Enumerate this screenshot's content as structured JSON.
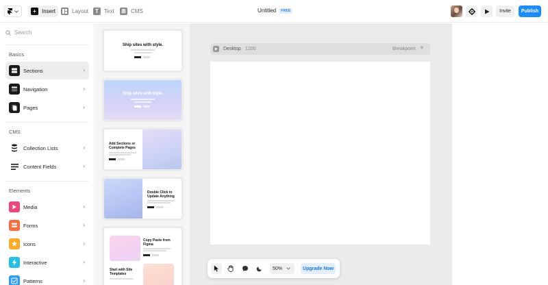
{
  "toolbar": {
    "tools": [
      {
        "label": "Insert",
        "icon": "plus-square-icon"
      },
      {
        "label": "Layout",
        "icon": "layout-icon"
      },
      {
        "label": "Text",
        "icon": "text-icon"
      },
      {
        "label": "CMS",
        "icon": "database-icon"
      }
    ],
    "title": "Untitled",
    "plan_badge": "FREE",
    "invite_label": "Invite",
    "publish_label": "Publish"
  },
  "sidebar": {
    "search_placeholder": "Search",
    "sections": [
      {
        "title": "Basics",
        "items": [
          {
            "label": "Sections",
            "icon": "sections-icon",
            "color": "#1a1a1a"
          },
          {
            "label": "Navigation",
            "icon": "navigation-icon",
            "color": "#1a1a1a"
          },
          {
            "label": "Pages",
            "icon": "pages-icon",
            "color": "#1a1a1a"
          }
        ]
      },
      {
        "title": "CMS",
        "items": [
          {
            "label": "Collection Lists",
            "icon": "stack-icon",
            "color": "#1a1a1a"
          },
          {
            "label": "Content Fields",
            "icon": "lines-icon",
            "color": "#1a1a1a"
          }
        ]
      },
      {
        "title": "Elements",
        "items": [
          {
            "label": "Media",
            "icon": "play-icon",
            "color": "#f0457a"
          },
          {
            "label": "Forms",
            "icon": "form-icon",
            "color": "#ff6b3d"
          },
          {
            "label": "Icons",
            "icon": "star-icon",
            "color": "#ffaa22"
          },
          {
            "label": "Interactive",
            "icon": "bolt-icon",
            "color": "#22c0e8"
          },
          {
            "label": "Patterns",
            "icon": "check-icon",
            "color": "#2e9cf0"
          }
        ]
      }
    ]
  },
  "templates": {
    "card1_title": "Ship sites with style.",
    "card2_title": "Ship sites with style.",
    "card3_title": "Add Sections or Complete Pages",
    "card4_title": "Double Click to Update Anything",
    "card5_title": "Copy Paste from Figma",
    "card5_subtitle": "Start with Site Templates"
  },
  "canvas": {
    "device": "Desktop",
    "width": "1200",
    "breakpoint_label": "Breakpoint"
  },
  "bottombar": {
    "zoom": "50%",
    "upgrade_label": "Upgrade Now"
  }
}
